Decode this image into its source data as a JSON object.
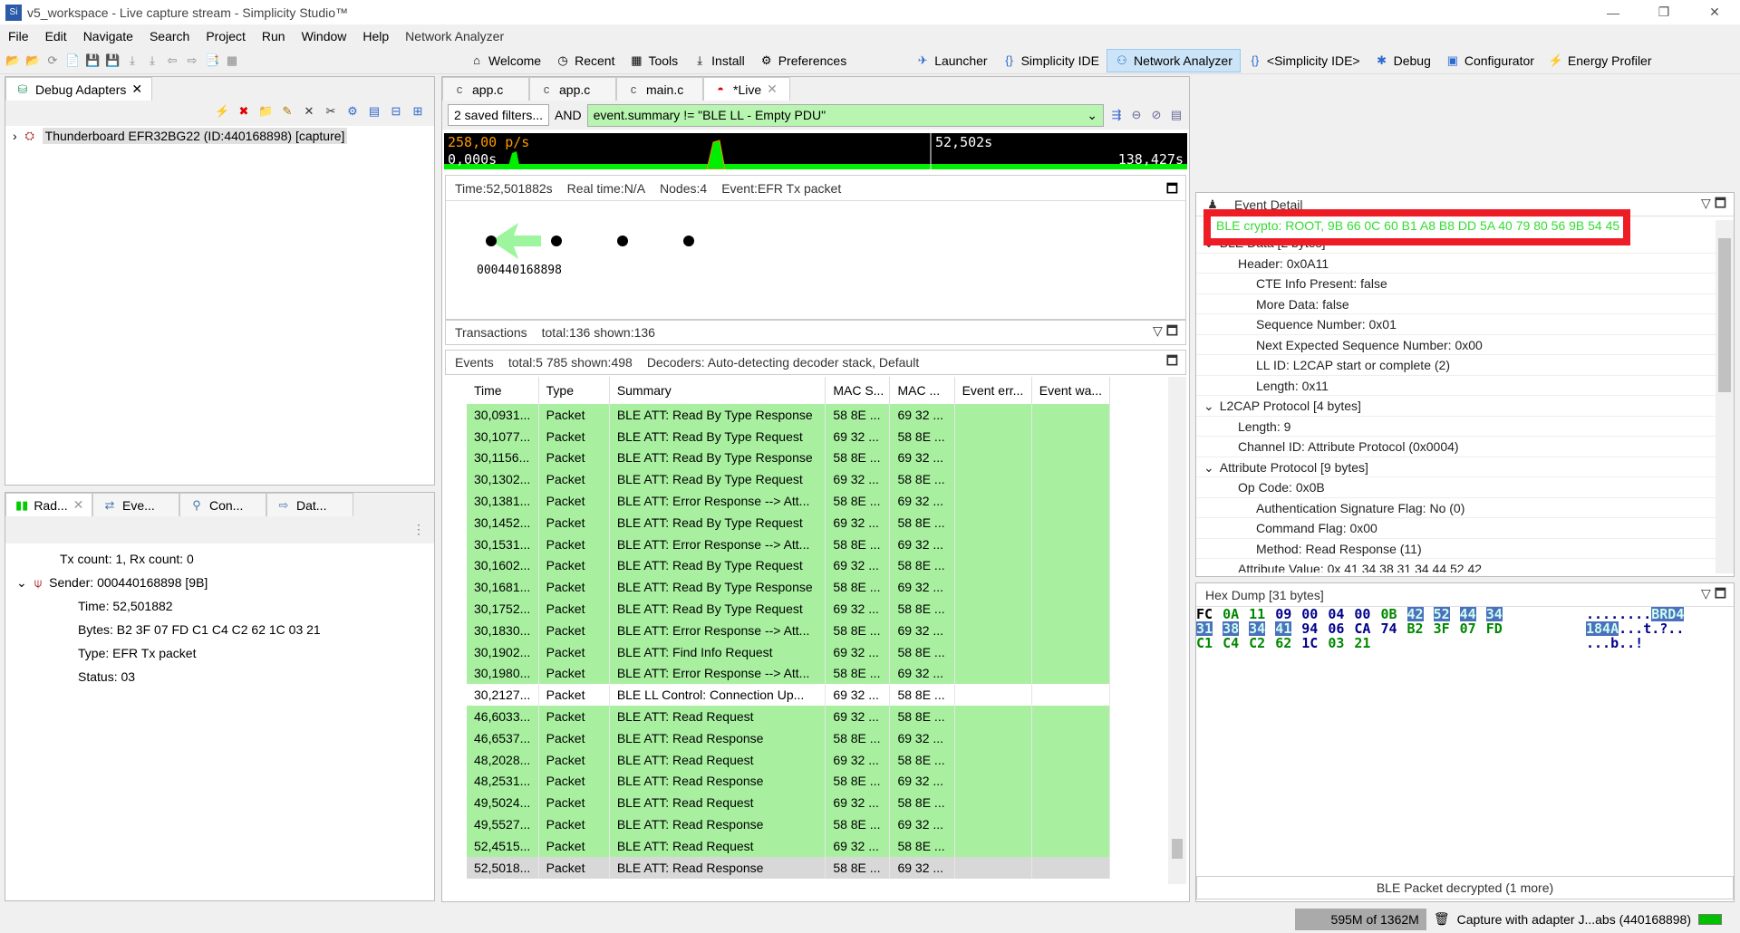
{
  "window": {
    "title": "v5_workspace - Live capture stream - Simplicity Studio™",
    "min": "—",
    "max": "❐",
    "close": "✕"
  },
  "menu": [
    "File",
    "Edit",
    "Navigate",
    "Search",
    "Project",
    "Run",
    "Window",
    "Help"
  ],
  "menu_extra": "Network Analyzer",
  "toolbar": {
    "items": [
      {
        "icon": "home-icon",
        "g": "⌂",
        "label": "Welcome"
      },
      {
        "icon": "recent-icon",
        "g": "◷",
        "label": "Recent"
      },
      {
        "icon": "tools-icon",
        "g": "▦",
        "label": "Tools"
      },
      {
        "icon": "install-icon",
        "g": "⤓",
        "label": "Install"
      },
      {
        "icon": "gear-icon",
        "g": "⚙",
        "label": "Preferences"
      }
    ],
    "perspectives": [
      {
        "icon": "launcher-icon",
        "g": "✈",
        "label": "Launcher",
        "active": false
      },
      {
        "icon": "braces-icon",
        "g": "{}",
        "label": "Simplicity IDE",
        "active": false
      },
      {
        "icon": "network-icon",
        "g": "⚇",
        "label": "Network Analyzer",
        "active": true
      },
      {
        "icon": "braces-icon",
        "g": "{}",
        "label": "<Simplicity IDE>",
        "active": false
      },
      {
        "icon": "bug-icon",
        "g": "✱",
        "label": "Debug",
        "active": false
      },
      {
        "icon": "chip-icon",
        "g": "▣",
        "label": "Configurator",
        "active": false
      },
      {
        "icon": "energy-icon",
        "g": "⚡",
        "label": "Energy Profiler",
        "active": false
      }
    ]
  },
  "debug_adapters": {
    "tab": "Debug Adapters",
    "device": "Thunderboard EFR32BG22 (ID:440168898) [capture]"
  },
  "bottom_left": {
    "tabs": [
      "Rad...",
      "Eve...",
      "Con...",
      "Dat..."
    ],
    "tx_rx": "Tx count: 1, Rx count: 0",
    "sender": "Sender: 000440168898 [9B]",
    "details": [
      "Time: 52,501882",
      "Bytes: B2 3F 07 FD C1 C4 C2 62 1C 03 21",
      "Type: EFR Tx packet",
      "Status: 03"
    ]
  },
  "editor_tabs": [
    {
      "label": "app.c",
      "active": false
    },
    {
      "label": "app.c",
      "active": false
    },
    {
      "label": "main.c",
      "active": false
    },
    {
      "label": "*Live",
      "active": true
    }
  ],
  "filter": {
    "saved": "2 saved filters...",
    "op": "AND",
    "value": "event.summary != \"BLE LL - Empty PDU\""
  },
  "timeline": {
    "rate": "258,00 p/s",
    "start": "0,000s",
    "cursor": "52,502s",
    "end": "138,427s"
  },
  "map": {
    "info": [
      "Time:52,501882s",
      "Real time:N/A",
      "Nodes:4",
      "Event:EFR Tx packet"
    ],
    "node_label": "000440168898"
  },
  "transactions": {
    "label": "Transactions",
    "summary": "total:136 shown:136"
  },
  "events": {
    "label": "Events",
    "summary": "total:5 785 shown:498",
    "decoders": "Decoders: Auto-detecting decoder stack, Default",
    "columns": [
      "Time",
      "Type",
      "Summary",
      "MAC S...",
      "MAC ...",
      "Event err...",
      "Event wa..."
    ],
    "rows": [
      [
        "30,0931...",
        "Packet",
        "BLE ATT: Read By Type Response",
        "58 8E ...",
        "69 32 ...",
        "g"
      ],
      [
        "30,1077...",
        "Packet",
        "BLE ATT: Read By Type Request",
        "69 32 ...",
        "58 8E ...",
        "g"
      ],
      [
        "30,1156...",
        "Packet",
        "BLE ATT: Read By Type Response",
        "58 8E ...",
        "69 32 ...",
        "g"
      ],
      [
        "30,1302...",
        "Packet",
        "BLE ATT: Read By Type Request",
        "69 32 ...",
        "58 8E ...",
        "g"
      ],
      [
        "30,1381...",
        "Packet",
        "BLE ATT: Error Response --> Att...",
        "58 8E ...",
        "69 32 ...",
        "g"
      ],
      [
        "30,1452...",
        "Packet",
        "BLE ATT: Read By Type Request",
        "69 32 ...",
        "58 8E ...",
        "g"
      ],
      [
        "30,1531...",
        "Packet",
        "BLE ATT: Error Response --> Att...",
        "58 8E ...",
        "69 32 ...",
        "g"
      ],
      [
        "30,1602...",
        "Packet",
        "BLE ATT: Read By Type Request",
        "69 32 ...",
        "58 8E ...",
        "g"
      ],
      [
        "30,1681...",
        "Packet",
        "BLE ATT: Read By Type Response",
        "58 8E ...",
        "69 32 ...",
        "g"
      ],
      [
        "30,1752...",
        "Packet",
        "BLE ATT: Read By Type Request",
        "69 32 ...",
        "58 8E ...",
        "g"
      ],
      [
        "30,1830...",
        "Packet",
        "BLE ATT: Error Response --> Att...",
        "58 8E ...",
        "69 32 ...",
        "g"
      ],
      [
        "30,1902...",
        "Packet",
        "BLE ATT: Find Info Request",
        "69 32 ...",
        "58 8E ...",
        "g"
      ],
      [
        "30,1980...",
        "Packet",
        "BLE ATT: Error Response --> Att...",
        "58 8E ...",
        "69 32 ...",
        "g"
      ],
      [
        "30,2127...",
        "Packet",
        "BLE LL Control: Connection Up...",
        "69 32 ...",
        "58 8E ...",
        "w"
      ],
      [
        "46,6033...",
        "Packet",
        "BLE ATT: Read Request",
        "69 32 ...",
        "58 8E ...",
        "g"
      ],
      [
        "46,6537...",
        "Packet",
        "BLE ATT: Read Response",
        "58 8E ...",
        "69 32 ...",
        "g"
      ],
      [
        "48,2028...",
        "Packet",
        "BLE ATT: Read Request",
        "69 32 ...",
        "58 8E ...",
        "g"
      ],
      [
        "48,2531...",
        "Packet",
        "BLE ATT: Read Response",
        "58 8E ...",
        "69 32 ...",
        "g"
      ],
      [
        "49,5024...",
        "Packet",
        "BLE ATT: Read Request",
        "69 32 ...",
        "58 8E ...",
        "g"
      ],
      [
        "49,5527...",
        "Packet",
        "BLE ATT: Read Response",
        "58 8E ...",
        "69 32 ...",
        "g"
      ],
      [
        "52,4515...",
        "Packet",
        "BLE ATT: Read Request",
        "69 32 ...",
        "58 8E ...",
        "g"
      ],
      [
        "52,5018...",
        "Packet",
        "BLE ATT: Read Response",
        "58 8E ...",
        "69 32 ...",
        "s"
      ]
    ]
  },
  "event_detail": {
    "title": "Event Detail",
    "crypto": "BLE crypto: ROOT, 9B 66 0C 60 B1 A8 B8 DD 5A 40 79 80 56 9B 54 45",
    "lines": [
      [
        "BLE Data [2 bytes]",
        0,
        true
      ],
      [
        "Header: 0x0A11",
        1,
        false
      ],
      [
        "CTE Info Present: false",
        2,
        false
      ],
      [
        "More Data: false",
        2,
        false
      ],
      [
        "Sequence Number: 0x01",
        2,
        false
      ],
      [
        "Next Expected Sequence Number: 0x00",
        2,
        false
      ],
      [
        "LL ID: L2CAP start or complete (2)",
        2,
        false
      ],
      [
        "Length: 0x11",
        2,
        false
      ],
      [
        "L2CAP Protocol [4 bytes]",
        0,
        true
      ],
      [
        "Length: 9",
        1,
        false
      ],
      [
        "Channel ID: Attribute Protocol (0x0004)",
        1,
        false
      ],
      [
        "Attribute Protocol [9 bytes]",
        0,
        true
      ],
      [
        "Op Code: 0x0B",
        1,
        false
      ],
      [
        "Authentication Signature Flag: No (0)",
        2,
        false
      ],
      [
        "Command Flag: 0x00",
        2,
        false
      ],
      [
        "Method: Read Response (11)",
        2,
        false
      ],
      [
        "Attribute Value: 0x 41 34 38 31 34 44 52 42",
        1,
        false
      ]
    ]
  },
  "hex_dump": {
    "title": "Hex Dump [31 bytes]",
    "rows": [
      [
        [
          "FC",
          "k"
        ],
        [
          "0A",
          "gr"
        ],
        [
          "11",
          "gr"
        ],
        [
          "09",
          "b"
        ],
        [
          "00",
          "b"
        ],
        [
          "04",
          "b"
        ],
        [
          "00",
          "b"
        ],
        [
          "0B",
          "gr"
        ],
        [
          "42",
          "h"
        ],
        [
          "52",
          "h"
        ],
        [
          "44",
          "h"
        ],
        [
          "34",
          "h"
        ]
      ],
      [
        [
          "31",
          "h"
        ],
        [
          "38",
          "h"
        ],
        [
          "34",
          "h"
        ],
        [
          "41",
          "h"
        ],
        [
          "94",
          "b"
        ],
        [
          "06",
          "b"
        ],
        [
          "CA",
          "b"
        ],
        [
          "74",
          "b"
        ],
        [
          "B2",
          "gr"
        ],
        [
          "3F",
          "gr"
        ],
        [
          "07",
          "gr"
        ],
        [
          "FD",
          "gr"
        ]
      ],
      [
        [
          "C1",
          "gr"
        ],
        [
          "C4",
          "gr"
        ],
        [
          "C2",
          "gr"
        ],
        [
          "62",
          "gr"
        ],
        [
          "1C",
          "b"
        ],
        [
          "03",
          "gr"
        ],
        [
          "21",
          "gr"
        ]
      ]
    ],
    "ascii": [
      [
        "........",
        "BRD4"
      ],
      [
        "184A",
        "...t.?.."
      ],
      [
        "...b..!",
        ""
      ]
    ],
    "footer": "BLE Packet decrypted (1 more)"
  },
  "status": {
    "memory": "595M of 1362M",
    "capture": "Capture with adapter J...abs (440168898)"
  },
  "colors": {
    "packet_bg": "#a8f0a0",
    "crypto_text": "#33dd33",
    "highlight_box": "#ee1c25",
    "timeline_fill": "#00ee00"
  }
}
